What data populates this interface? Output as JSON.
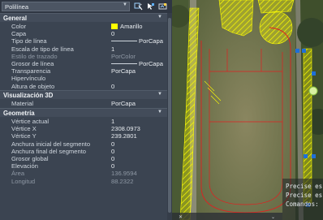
{
  "palette": {
    "object_type": "Polilínea",
    "sections": [
      {
        "title": "General",
        "rows": [
          {
            "label": "Color",
            "value": "Amarillo",
            "swatch": "#ffff00"
          },
          {
            "label": "Capa",
            "value": "0"
          },
          {
            "label": "Tipo de línea",
            "value": "PorCapa",
            "line": true
          },
          {
            "label": "Escala de tipo de línea",
            "value": "1"
          },
          {
            "label": "Estilo de trazado",
            "value": "PorColor",
            "dim": true
          },
          {
            "label": "Grosor de línea",
            "value": "PorCapa",
            "line": true
          },
          {
            "label": "Transparencia",
            "value": "PorCapa"
          },
          {
            "label": "Hipervínculo",
            "value": ""
          },
          {
            "label": "Altura de objeto",
            "value": "0"
          }
        ]
      },
      {
        "title": "Visualización 3D",
        "rows": [
          {
            "label": "Material",
            "value": "PorCapa"
          }
        ]
      },
      {
        "title": "Geometría",
        "rows": [
          {
            "label": "Vértice actual",
            "value": "1"
          },
          {
            "label": "Vértice X",
            "value": "2308.0973"
          },
          {
            "label": "Vértice Y",
            "value": "239.2801"
          },
          {
            "label": "Anchura inicial del segmento",
            "value": "0"
          },
          {
            "label": "Anchura final del segmento",
            "value": "0"
          },
          {
            "label": "Grosor global",
            "value": "0"
          },
          {
            "label": "Elevación",
            "value": "0"
          },
          {
            "label": "Área",
            "value": "136.9594",
            "dim": true
          },
          {
            "label": "Longitud",
            "value": "88.2322",
            "dim": true
          }
        ]
      }
    ]
  },
  "drawing": {
    "command_lines": [
      "Precise es",
      "Precise es",
      "Comandos:"
    ],
    "colors": {
      "selection": "#ffff00",
      "boundary": "#e02020",
      "grip": "#1e6fd9"
    }
  }
}
